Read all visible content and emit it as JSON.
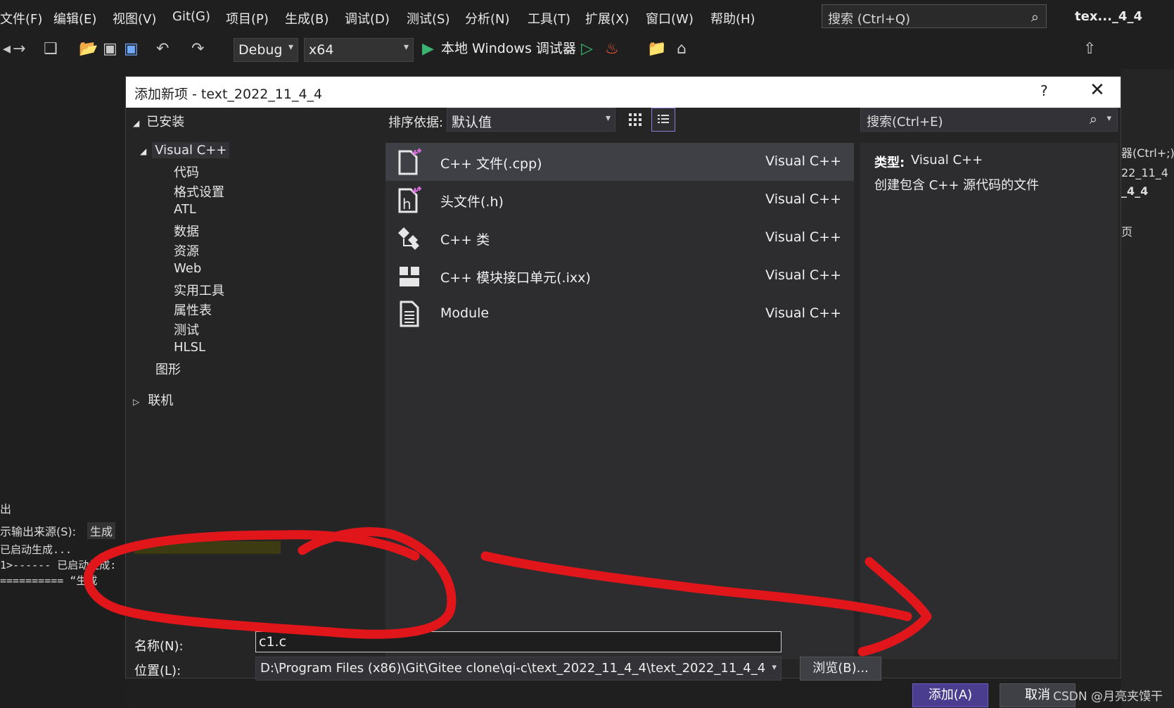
{
  "menubar": {
    "items": [
      "文件(F)",
      "编辑(E)",
      "视图(V)",
      "Git(G)",
      "项目(P)",
      "生成(B)",
      "调试(D)",
      "测试(S)",
      "分析(N)",
      "工具(T)",
      "扩展(X)",
      "窗口(W)",
      "帮助(H)"
    ],
    "search_placeholder": "搜索 (Ctrl+Q)",
    "window_title": "tex..._4_4"
  },
  "toolbar": {
    "config": "Debug",
    "platform": "x64",
    "run_label": "本地 Windows 调试器"
  },
  "background": {
    "right_lines": [
      "器(Ctrl+;)",
      "22_11_4",
      "_4_4",
      "页"
    ],
    "output_title": "出",
    "output_source_label": "示输出来源(S):",
    "output_source_value": "生成",
    "output_lines": [
      "已启动生成...",
      "1>------ 已启动生成:",
      "========== “生成"
    ]
  },
  "dialog": {
    "title": "添加新项 - text_2022_11_4_4",
    "help": "?",
    "close": "✕",
    "tree": {
      "installed": "已安装",
      "visual_cpp": "Visual C++",
      "children": [
        "代码",
        "格式设置",
        "ATL",
        "数据",
        "资源",
        "Web",
        "实用工具",
        "属性表",
        "测试",
        "HLSL"
      ],
      "graphics": "图形",
      "online": "联机"
    },
    "sort_label": "排序依据:",
    "sort_value": "默认值",
    "search_placeholder": "搜索(Ctrl+E)",
    "items": [
      {
        "name": "C++ 文件(.cpp)",
        "type": "Visual C++",
        "icon": "cpp-file-icon"
      },
      {
        "name": "头文件(.h)",
        "type": "Visual C++",
        "icon": "header-file-icon"
      },
      {
        "name": "C++ 类",
        "type": "Visual C++",
        "icon": "class-icon"
      },
      {
        "name": "C++ 模块接口单元(.ixx)",
        "type": "Visual C++",
        "icon": "module-unit-icon"
      },
      {
        "name": "Module",
        "type": "Visual C++",
        "icon": "module-document-icon"
      }
    ],
    "selected_index": 0,
    "desc_type_label": "类型:",
    "desc_type_value": "Visual C++",
    "desc_text": "创建包含 C++ 源代码的文件",
    "name_label": "名称(N):",
    "name_value": "c1.c",
    "location_label": "位置(L):",
    "location_value": "D:\\Program Files (x86)\\Git\\Gitee clone\\qi-c\\text_2022_11_4_4\\text_2022_11_4_4",
    "browse": "浏览(B)...",
    "add": "添加(A)",
    "cancel": "取消"
  },
  "watermark": "CSDN @月亮夹馍干",
  "colors": {
    "accent": "#4a3d8f",
    "annotation": "#e0161b",
    "run_green": "#3cb371"
  }
}
